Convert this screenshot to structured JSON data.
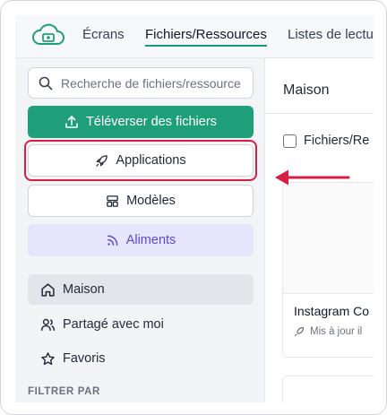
{
  "nav": {
    "tabs": [
      {
        "label": "Écrans",
        "active": false
      },
      {
        "label": "Fichiers/Ressources",
        "active": true
      },
      {
        "label": "Listes de lectu",
        "active": false
      }
    ]
  },
  "sidebar": {
    "search_placeholder": "Recherche de fichiers/ressource",
    "upload_label": "Téléverser des fichiers",
    "apps_label": "Applications",
    "models_label": "Modèles",
    "feeds_label": "Aliments",
    "items": [
      {
        "label": "Maison",
        "icon": "home-icon",
        "active": true
      },
      {
        "label": "Partagé avec moi",
        "icon": "users-icon",
        "active": false
      },
      {
        "label": "Favoris",
        "icon": "star-icon",
        "active": false
      }
    ],
    "filter_label": "FILTRER PAR"
  },
  "main": {
    "title": "Maison",
    "select_all_label": "Fichiers/Re",
    "card": {
      "title": "Instagram Co",
      "meta": "Mis à jour il"
    }
  },
  "colors": {
    "accent": "#1f9f79",
    "highlight": "#d81e43",
    "feeds_bg": "#e7e5fb",
    "feeds_text": "#5b4ccf"
  }
}
